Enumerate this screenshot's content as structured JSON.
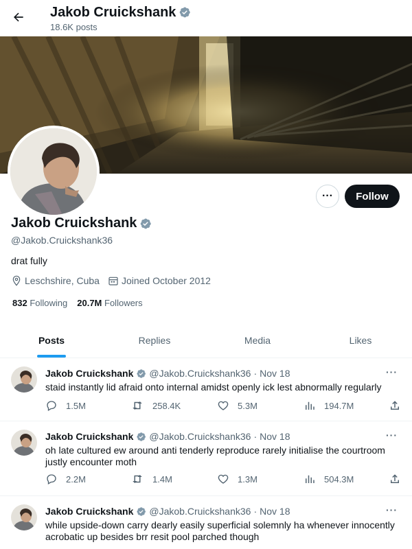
{
  "header": {
    "title": "Jakob Cruickshank",
    "posts_count": "18.6K posts"
  },
  "profile": {
    "name": "Jakob Cruickshank",
    "handle": "@Jakob.Cruickshank36",
    "bio": "drat fully",
    "location": "Leschshire, Cuba",
    "joined": "Joined October 2012",
    "following_count": "832",
    "following_label": "Following",
    "followers_count": "20.7M",
    "followers_label": "Followers",
    "follow_label": "Follow",
    "more_label": "···",
    "verified_color": "#829aab"
  },
  "tabs": [
    {
      "label": "Posts",
      "active": true
    },
    {
      "label": "Replies",
      "active": false
    },
    {
      "label": "Media",
      "active": false
    },
    {
      "label": "Likes",
      "active": false
    }
  ],
  "posts": [
    {
      "name": "Jakob Cruickshank",
      "handle": "@Jakob.Cruickshank36",
      "separator": "·",
      "date": "Nov 18",
      "more": "···",
      "text": "staid instantly lid afraid onto internal amidst openly ick lest abnormally regularly",
      "replies": "1.5M",
      "reposts": "258.4K",
      "likes": "5.3M",
      "views": "194.7M"
    },
    {
      "name": "Jakob Cruickshank",
      "handle": "@Jakob.Cruickshank36",
      "separator": "·",
      "date": "Nov 18",
      "more": "···",
      "text": "oh late cultured ew around anti tenderly reproduce rarely initialise the courtroom justly encounter moth",
      "replies": "2.2M",
      "reposts": "1.4M",
      "likes": "1.3M",
      "views": "504.3M"
    },
    {
      "name": "Jakob Cruickshank",
      "handle": "@Jakob.Cruickshank36",
      "separator": "·",
      "date": "Nov 18",
      "more": "···",
      "text": "while upside-down carry dearly easily superficial solemnly ha whenever innocently acrobatic up besides brr resit pool parched though"
    }
  ]
}
